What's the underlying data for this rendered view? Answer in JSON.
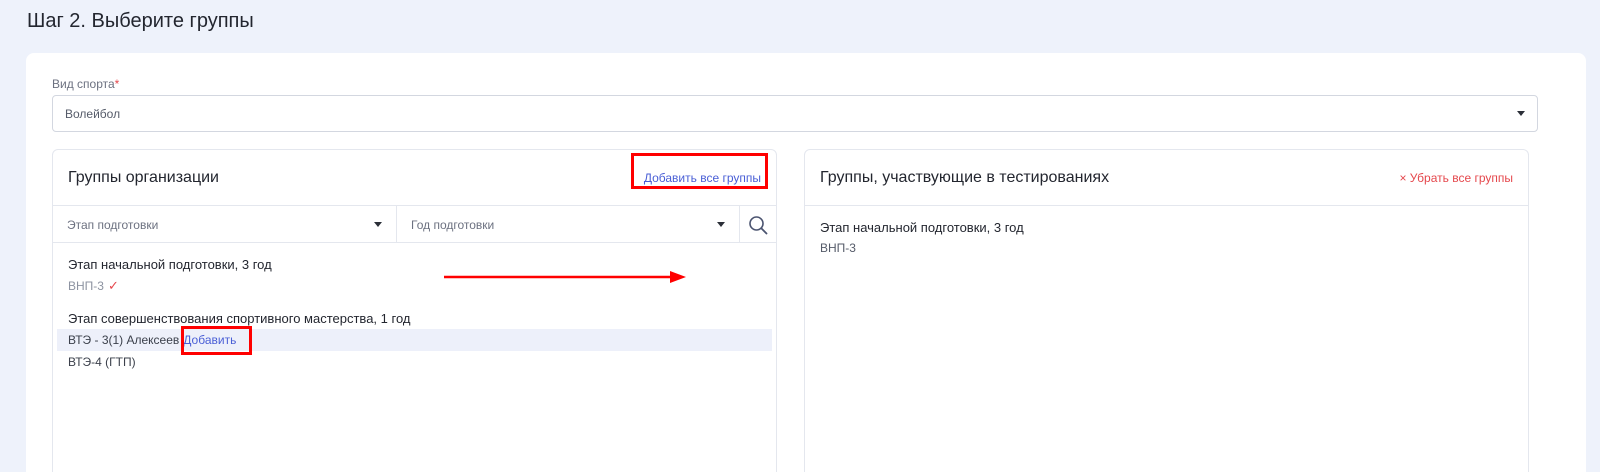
{
  "page": {
    "title": "Шаг 2. Выберите группы"
  },
  "sport_field": {
    "label": "Вид спорта",
    "required_mark": "*",
    "value": "Волейбол"
  },
  "org_groups": {
    "title": "Группы организации",
    "add_all_label": "Добавить все группы",
    "filters": {
      "stage_placeholder": "Этап подготовки",
      "year_placeholder": "Год подготовки"
    },
    "stages": [
      {
        "title": "Этап начальной подготовки, 3 год",
        "groups": [
          {
            "name": "ВНП-3",
            "added": true
          }
        ]
      },
      {
        "title": "Этап совершенствования спортивного мастерства, 1 год",
        "groups": [
          {
            "name": "ВТЭ - 3(1) Алексеев",
            "action": "Добавить"
          },
          {
            "name": "ВТЭ-4 (ГТП)"
          }
        ]
      }
    ]
  },
  "testing_groups": {
    "title": "Группы, участвующие в тестированиях",
    "remove_all_label": "× Убрать все группы",
    "stages": [
      {
        "title": "Этап начальной подготовки, 3 год",
        "groups": [
          {
            "name": "ВНП-3"
          }
        ]
      }
    ]
  },
  "colors": {
    "accent": "#4a5fd6",
    "danger": "#e5484d",
    "annotation": "#ff0000",
    "background": "#eef2fb"
  },
  "icons": [
    "chevron-down-icon",
    "search-icon",
    "checkmark-icon"
  ]
}
